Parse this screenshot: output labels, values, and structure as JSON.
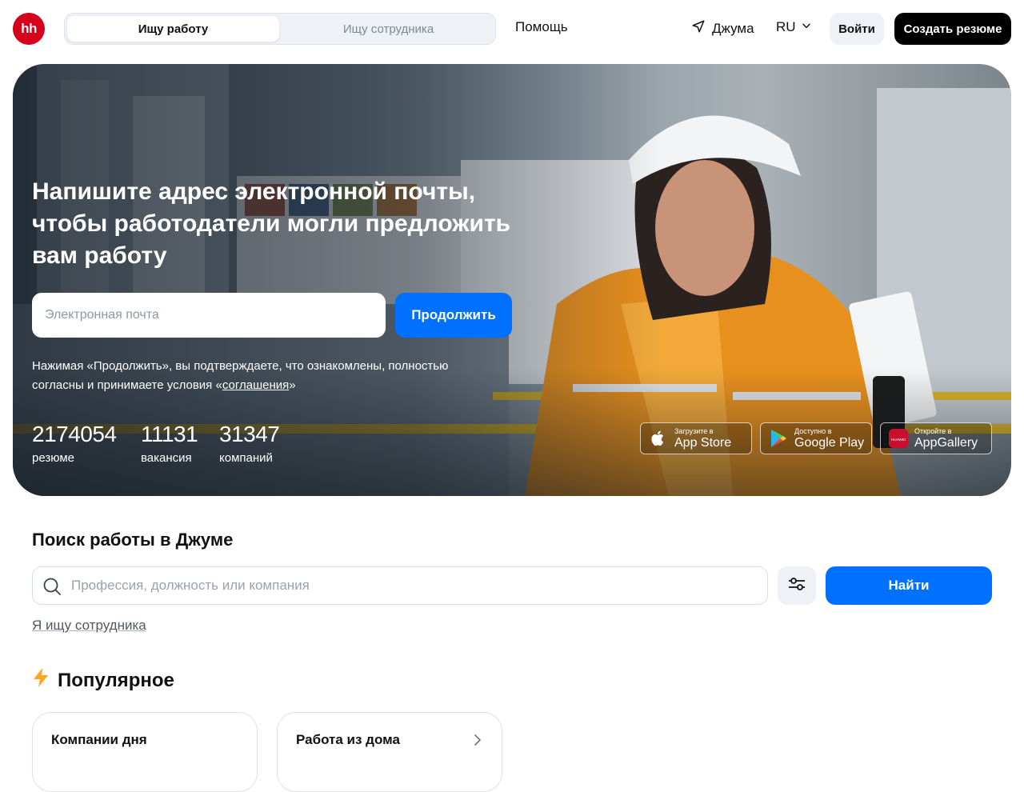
{
  "header": {
    "logo_text": "hh",
    "tabs": [
      {
        "label": "Ищу работу",
        "active": true
      },
      {
        "label": "Ищу сотрудника",
        "active": false
      }
    ],
    "help": "Помощь",
    "location": "Джума",
    "language": "RU",
    "login": "Войти",
    "create_resume": "Создать резюме"
  },
  "hero": {
    "title": "Напишите адрес электронной почты, чтобы работодатели могли предложить вам работу",
    "email_placeholder": "Электронная почта",
    "continue": "Продолжить",
    "consent_text": "Нажимая «Продолжить», вы подтверждаете, что ознакомлены, полностью согласны и принимаете условия «",
    "consent_link": "соглашения",
    "consent_end": "»",
    "stats": [
      {
        "value": "2174054",
        "label": "резюме"
      },
      {
        "value": "11131",
        "label": "вакансия"
      },
      {
        "value": "31347",
        "label": "компаний"
      }
    ],
    "stores": [
      {
        "small": "Загрузите в",
        "big": "App Store",
        "icon": "apple-icon"
      },
      {
        "small": "Доступно в",
        "big": "Google Play",
        "icon": "google-play-icon"
      },
      {
        "small": "Откройте в",
        "big": "AppGallery",
        "icon": "huawei-icon",
        "icon_text": "HUAWEI"
      }
    ]
  },
  "search": {
    "title": "Поиск работы в Джуме",
    "placeholder": "Профессия, должность или компания",
    "find": "Найти",
    "employer_link": "Я ищу сотрудника"
  },
  "popular": {
    "title": "Популярное",
    "cards": [
      {
        "label": "Компании дня"
      },
      {
        "label": "Работа из дома"
      }
    ]
  },
  "colors": {
    "brand": "#d6001c",
    "accent": "#0070ff",
    "lightning": "#ffa51f"
  }
}
